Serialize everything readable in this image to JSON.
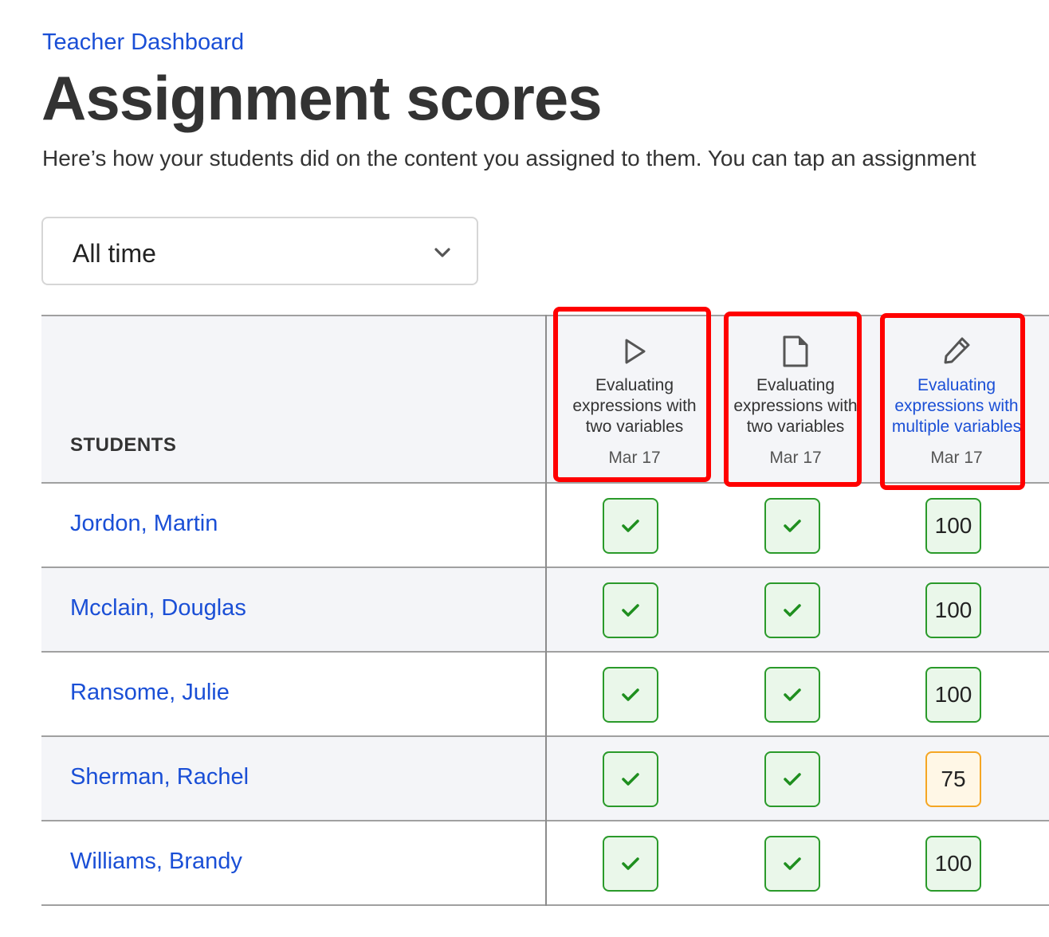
{
  "breadcrumb": {
    "label": "Teacher Dashboard"
  },
  "page": {
    "title": "Assignment scores",
    "description": "Here’s how your students did on the content you assigned to them. You can tap an assignment"
  },
  "filter": {
    "selected": "All time",
    "icon": "chevron-down-icon"
  },
  "table": {
    "students_header": "STUDENTS",
    "assignments": [
      {
        "icon": "play-icon",
        "name_line1": "Evaluating",
        "name_line2": "expressions with",
        "name_line3": "two variables",
        "date": "Mar 17",
        "is_link": false,
        "highlighted": true
      },
      {
        "icon": "document-icon",
        "name_line1": "Evaluating",
        "name_line2": "expressions with",
        "name_line3": "two variables",
        "date": "Mar 17",
        "is_link": false,
        "highlighted": true
      },
      {
        "icon": "pencil-icon",
        "name_line1": "Evaluating",
        "name_line2": "expressions with",
        "name_line3": "multiple variables",
        "date": "Mar 17",
        "is_link": true,
        "highlighted": true
      }
    ],
    "rows": [
      {
        "student": "Jordon, Martin",
        "scores": [
          "check",
          "check",
          "100"
        ]
      },
      {
        "student": "Mcclain, Douglas",
        "scores": [
          "check",
          "check",
          "100"
        ]
      },
      {
        "student": "Ransome, Julie",
        "scores": [
          "check",
          "check",
          "100"
        ]
      },
      {
        "student": "Sherman, Rachel",
        "scores": [
          "check",
          "check",
          "75"
        ]
      },
      {
        "student": "Williams, Brandy",
        "scores": [
          "check",
          "check",
          "100"
        ]
      }
    ]
  },
  "colors": {
    "link": "#1a4fd6",
    "complete_border": "#2a9a2a",
    "complete_bg": "#eaf7ea",
    "warning_border": "#f5a623",
    "warning_bg": "#fff7e6",
    "highlight": "#ff0000"
  }
}
